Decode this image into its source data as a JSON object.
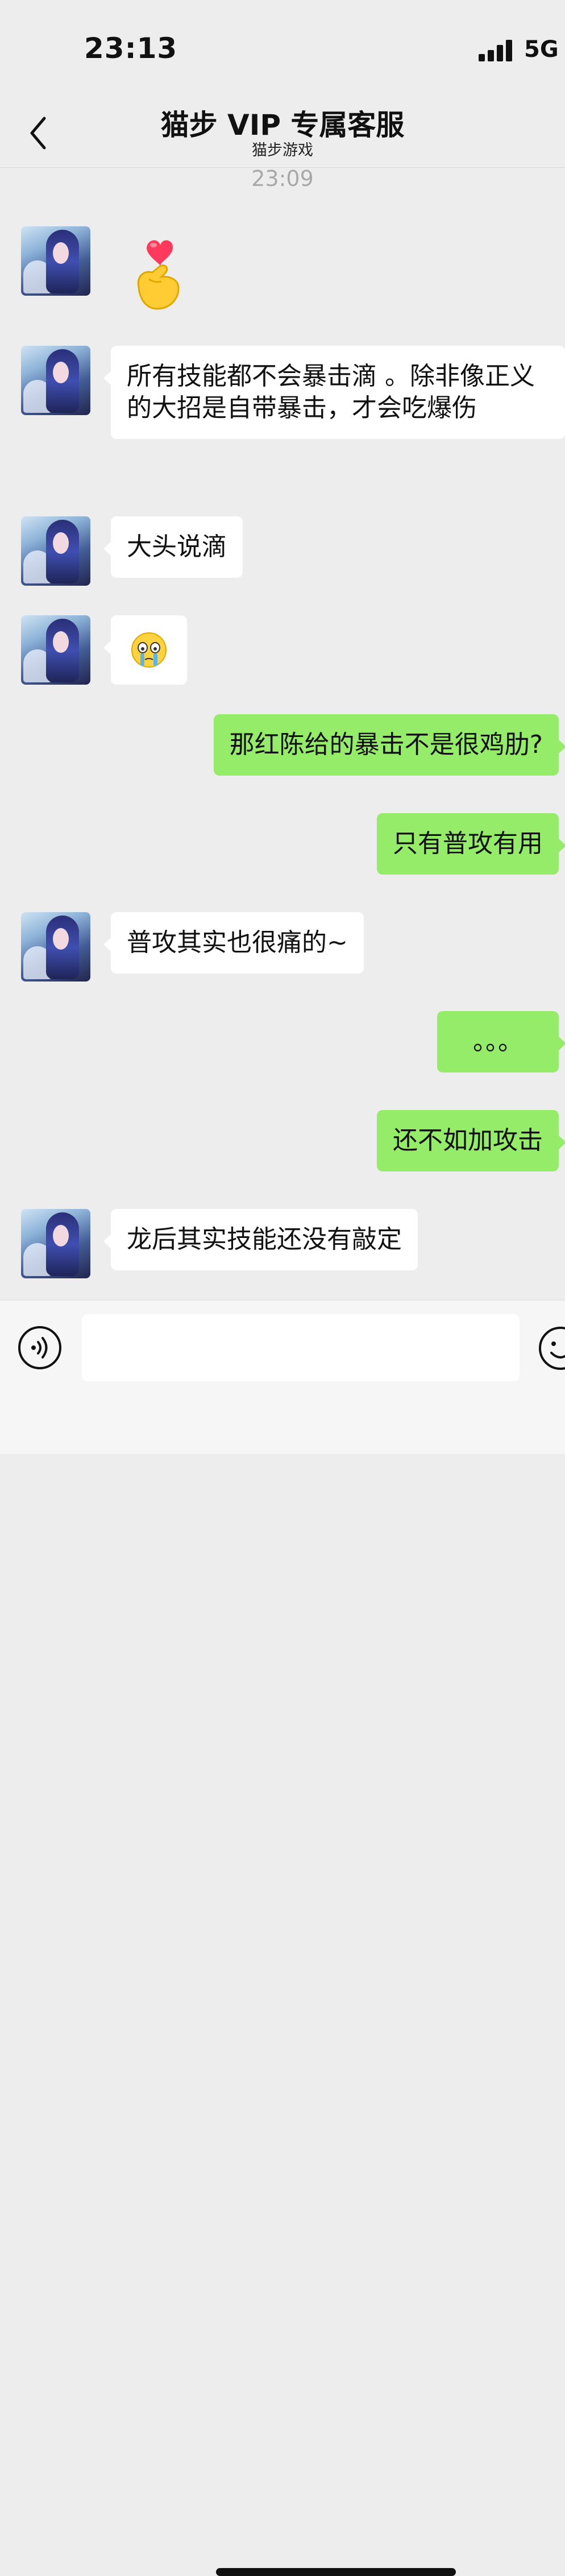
{
  "status_bar": {
    "time": "23:13",
    "network": "5G"
  },
  "nav": {
    "title": "猫步 VIP 专属客服",
    "subtitle": "猫步游戏"
  },
  "chat": {
    "timestamp": "23:09",
    "messages": [
      {
        "side": "in",
        "type": "sticker",
        "icon": "finger-heart-emoji"
      },
      {
        "side": "in",
        "type": "text",
        "text": "所有技能都不会暴击滴 。除非像正义的大招是自带暴击，才会吃爆伤"
      },
      {
        "side": "in",
        "type": "text",
        "text": "大头说滴"
      },
      {
        "side": "in",
        "type": "emoji",
        "icon": "crying-face-emoji"
      },
      {
        "side": "out",
        "type": "text",
        "text": "那红陈给的暴击不是很鸡肋?"
      },
      {
        "side": "out",
        "type": "text",
        "text": "只有普攻有用"
      },
      {
        "side": "in",
        "type": "text",
        "text": "普攻其实也很痛的~"
      },
      {
        "side": "out",
        "type": "text",
        "text": "。。。"
      },
      {
        "side": "out",
        "type": "text",
        "text": "还不如加攻击"
      },
      {
        "side": "in",
        "type": "text",
        "text": "龙后其实技能还没有敲定"
      }
    ]
  },
  "input_bar": {
    "value": "",
    "voice_icon": "voice-icon",
    "emoji_icon": "emoji-icon"
  },
  "colors": {
    "background": "#ededed",
    "bubble_in": "#ffffff",
    "bubble_out": "#95ec69",
    "timestamp": "#a9a9a9"
  }
}
